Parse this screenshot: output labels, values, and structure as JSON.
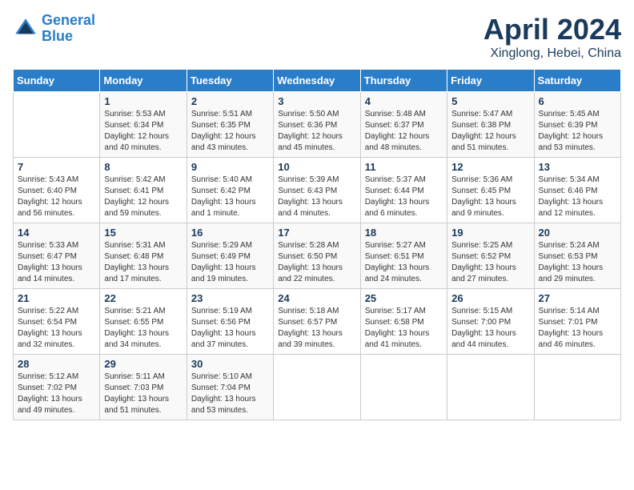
{
  "header": {
    "logo_line1": "General",
    "logo_line2": "Blue",
    "title": "April 2024",
    "subtitle": "Xinglong, Hebei, China"
  },
  "calendar": {
    "days_of_week": [
      "Sunday",
      "Monday",
      "Tuesday",
      "Wednesday",
      "Thursday",
      "Friday",
      "Saturday"
    ],
    "weeks": [
      [
        {
          "day": "",
          "detail": ""
        },
        {
          "day": "1",
          "detail": "Sunrise: 5:53 AM\nSunset: 6:34 PM\nDaylight: 12 hours\nand 40 minutes."
        },
        {
          "day": "2",
          "detail": "Sunrise: 5:51 AM\nSunset: 6:35 PM\nDaylight: 12 hours\nand 43 minutes."
        },
        {
          "day": "3",
          "detail": "Sunrise: 5:50 AM\nSunset: 6:36 PM\nDaylight: 12 hours\nand 45 minutes."
        },
        {
          "day": "4",
          "detail": "Sunrise: 5:48 AM\nSunset: 6:37 PM\nDaylight: 12 hours\nand 48 minutes."
        },
        {
          "day": "5",
          "detail": "Sunrise: 5:47 AM\nSunset: 6:38 PM\nDaylight: 12 hours\nand 51 minutes."
        },
        {
          "day": "6",
          "detail": "Sunrise: 5:45 AM\nSunset: 6:39 PM\nDaylight: 12 hours\nand 53 minutes."
        }
      ],
      [
        {
          "day": "7",
          "detail": "Sunrise: 5:43 AM\nSunset: 6:40 PM\nDaylight: 12 hours\nand 56 minutes."
        },
        {
          "day": "8",
          "detail": "Sunrise: 5:42 AM\nSunset: 6:41 PM\nDaylight: 12 hours\nand 59 minutes."
        },
        {
          "day": "9",
          "detail": "Sunrise: 5:40 AM\nSunset: 6:42 PM\nDaylight: 13 hours\nand 1 minute."
        },
        {
          "day": "10",
          "detail": "Sunrise: 5:39 AM\nSunset: 6:43 PM\nDaylight: 13 hours\nand 4 minutes."
        },
        {
          "day": "11",
          "detail": "Sunrise: 5:37 AM\nSunset: 6:44 PM\nDaylight: 13 hours\nand 6 minutes."
        },
        {
          "day": "12",
          "detail": "Sunrise: 5:36 AM\nSunset: 6:45 PM\nDaylight: 13 hours\nand 9 minutes."
        },
        {
          "day": "13",
          "detail": "Sunrise: 5:34 AM\nSunset: 6:46 PM\nDaylight: 13 hours\nand 12 minutes."
        }
      ],
      [
        {
          "day": "14",
          "detail": "Sunrise: 5:33 AM\nSunset: 6:47 PM\nDaylight: 13 hours\nand 14 minutes."
        },
        {
          "day": "15",
          "detail": "Sunrise: 5:31 AM\nSunset: 6:48 PM\nDaylight: 13 hours\nand 17 minutes."
        },
        {
          "day": "16",
          "detail": "Sunrise: 5:29 AM\nSunset: 6:49 PM\nDaylight: 13 hours\nand 19 minutes."
        },
        {
          "day": "17",
          "detail": "Sunrise: 5:28 AM\nSunset: 6:50 PM\nDaylight: 13 hours\nand 22 minutes."
        },
        {
          "day": "18",
          "detail": "Sunrise: 5:27 AM\nSunset: 6:51 PM\nDaylight: 13 hours\nand 24 minutes."
        },
        {
          "day": "19",
          "detail": "Sunrise: 5:25 AM\nSunset: 6:52 PM\nDaylight: 13 hours\nand 27 minutes."
        },
        {
          "day": "20",
          "detail": "Sunrise: 5:24 AM\nSunset: 6:53 PM\nDaylight: 13 hours\nand 29 minutes."
        }
      ],
      [
        {
          "day": "21",
          "detail": "Sunrise: 5:22 AM\nSunset: 6:54 PM\nDaylight: 13 hours\nand 32 minutes."
        },
        {
          "day": "22",
          "detail": "Sunrise: 5:21 AM\nSunset: 6:55 PM\nDaylight: 13 hours\nand 34 minutes."
        },
        {
          "day": "23",
          "detail": "Sunrise: 5:19 AM\nSunset: 6:56 PM\nDaylight: 13 hours\nand 37 minutes."
        },
        {
          "day": "24",
          "detail": "Sunrise: 5:18 AM\nSunset: 6:57 PM\nDaylight: 13 hours\nand 39 minutes."
        },
        {
          "day": "25",
          "detail": "Sunrise: 5:17 AM\nSunset: 6:58 PM\nDaylight: 13 hours\nand 41 minutes."
        },
        {
          "day": "26",
          "detail": "Sunrise: 5:15 AM\nSunset: 7:00 PM\nDaylight: 13 hours\nand 44 minutes."
        },
        {
          "day": "27",
          "detail": "Sunrise: 5:14 AM\nSunset: 7:01 PM\nDaylight: 13 hours\nand 46 minutes."
        }
      ],
      [
        {
          "day": "28",
          "detail": "Sunrise: 5:12 AM\nSunset: 7:02 PM\nDaylight: 13 hours\nand 49 minutes."
        },
        {
          "day": "29",
          "detail": "Sunrise: 5:11 AM\nSunset: 7:03 PM\nDaylight: 13 hours\nand 51 minutes."
        },
        {
          "day": "30",
          "detail": "Sunrise: 5:10 AM\nSunset: 7:04 PM\nDaylight: 13 hours\nand 53 minutes."
        },
        {
          "day": "",
          "detail": ""
        },
        {
          "day": "",
          "detail": ""
        },
        {
          "day": "",
          "detail": ""
        },
        {
          "day": "",
          "detail": ""
        }
      ]
    ]
  }
}
